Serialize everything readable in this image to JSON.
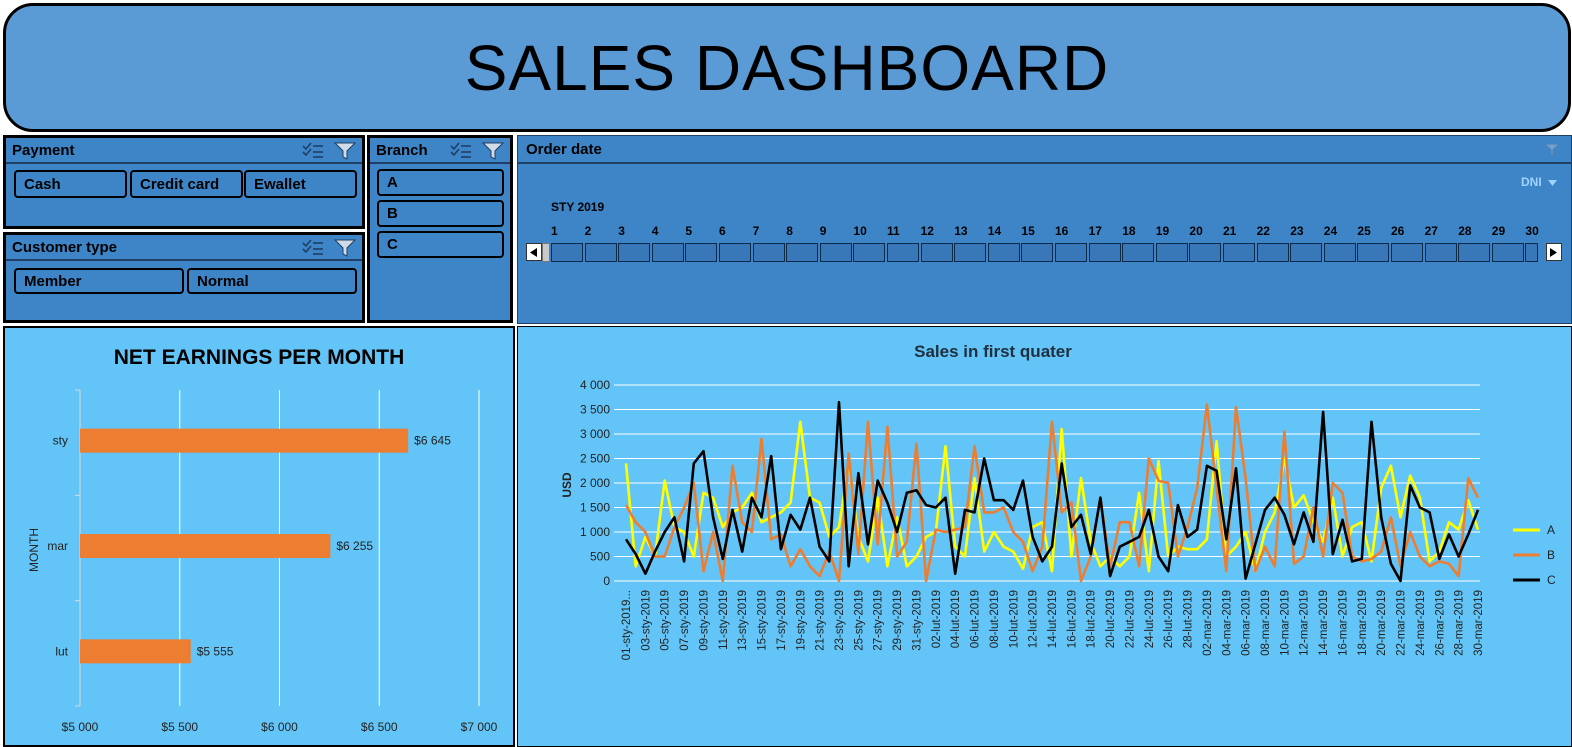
{
  "header": {
    "title": "SALES DASHBOARD"
  },
  "payment_slicer": {
    "title": "Payment",
    "items": [
      {
        "label": "Cash"
      },
      {
        "label": "Credit card"
      },
      {
        "label": "Ewallet"
      }
    ],
    "icons": [
      "multi-select-icon",
      "clear-filter-icon"
    ]
  },
  "customer_slicer": {
    "title": "Customer type",
    "items": [
      {
        "label": "Member"
      },
      {
        "label": "Normal"
      }
    ],
    "icons": [
      "multi-select-icon",
      "clear-filter-icon"
    ]
  },
  "branch_slicer": {
    "title": "Branch",
    "items": [
      {
        "label": "A"
      },
      {
        "label": "B"
      },
      {
        "label": "C"
      }
    ],
    "icons": [
      "multi-select-icon",
      "clear-filter-icon"
    ]
  },
  "timeline": {
    "title": "Order date",
    "level": "DNI",
    "month": "STY 2019",
    "days": [
      "1",
      "2",
      "3",
      "4",
      "5",
      "6",
      "7",
      "8",
      "9",
      "10",
      "11",
      "12",
      "13",
      "14",
      "15",
      "16",
      "17",
      "18",
      "19",
      "20",
      "21",
      "22",
      "23",
      "24",
      "25",
      "26",
      "27",
      "28",
      "29",
      "30"
    ],
    "icons": [
      "clear-filter-icon",
      "scroll-left-icon",
      "scroll-right-icon",
      "chevron-down-icon"
    ]
  },
  "colors": {
    "panel": "#63c5f7",
    "slicer": "#3d85c6",
    "header": "#5b9bd5",
    "bar": "#ed7d31",
    "seriesA": "#ffff00",
    "seriesB": "#ed7d31",
    "seriesC": "#000000"
  },
  "chart_data": [
    {
      "type": "bar",
      "orientation": "horizontal",
      "title": "NET EARNINGS PER MONTH",
      "ylabel": "MONTH",
      "categories": [
        "sty",
        "mar",
        "lut"
      ],
      "values": [
        6645,
        6255,
        5555
      ],
      "data_labels": [
        "$6 645",
        "$6 255",
        "$5 555"
      ],
      "xlim": [
        5000,
        7000
      ],
      "xticks": [
        5000,
        5500,
        6000,
        6500,
        7000
      ],
      "xtick_labels": [
        "$5 000",
        "$5 500",
        "$6 000",
        "$6 500",
        "$7 000"
      ],
      "grid": true
    },
    {
      "type": "line",
      "title": "Sales in first quater",
      "ylabel": "USD",
      "ylim": [
        0,
        4000
      ],
      "yticks": [
        0,
        500,
        1000,
        1500,
        2000,
        2500,
        3000,
        3500,
        4000
      ],
      "ytick_labels": [
        "0",
        "500",
        "1 000",
        "1 500",
        "2 000",
        "2 500",
        "3 000",
        "3 500",
        "4 000"
      ],
      "legend": "right",
      "x": [
        "01-sty-2019",
        "02-sty-2019",
        "03-sty-2019",
        "04-sty-2019",
        "05-sty-2019",
        "06-sty-2019",
        "07-sty-2019",
        "08-sty-2019",
        "09-sty-2019",
        "10-sty-2019",
        "11-sty-2019",
        "12-sty-2019",
        "13-sty-2019",
        "14-sty-2019",
        "15-sty-2019",
        "16-sty-2019",
        "17-sty-2019",
        "18-sty-2019",
        "19-sty-2019",
        "20-sty-2019",
        "21-sty-2019",
        "22-sty-2019",
        "23-sty-2019",
        "24-sty-2019",
        "25-sty-2019",
        "26-sty-2019",
        "27-sty-2019",
        "28-sty-2019",
        "29-sty-2019",
        "30-sty-2019",
        "31-sty-2019",
        "01-lut-2019",
        "02-lut-2019",
        "03-lut-2019",
        "04-lut-2019",
        "05-lut-2019",
        "06-lut-2019",
        "07-lut-2019",
        "08-lut-2019",
        "09-lut-2019",
        "10-lut-2019",
        "11-lut-2019",
        "12-lut-2019",
        "13-lut-2019",
        "14-lut-2019",
        "15-lut-2019",
        "16-lut-2019",
        "17-lut-2019",
        "18-lut-2019",
        "19-lut-2019",
        "20-lut-2019",
        "21-lut-2019",
        "22-lut-2019",
        "23-lut-2019",
        "24-lut-2019",
        "25-lut-2019",
        "26-lut-2019",
        "27-lut-2019",
        "28-lut-2019",
        "01-mar-2019",
        "02-mar-2019",
        "03-mar-2019",
        "04-mar-2019",
        "05-mar-2019",
        "06-mar-2019",
        "07-mar-2019",
        "08-mar-2019",
        "09-mar-2019",
        "10-mar-2019",
        "11-mar-2019",
        "12-mar-2019",
        "13-mar-2019",
        "14-mar-2019",
        "15-mar-2019",
        "16-mar-2019",
        "17-mar-2019",
        "18-mar-2019",
        "19-mar-2019",
        "20-mar-2019",
        "21-mar-2019",
        "22-mar-2019",
        "23-mar-2019",
        "24-mar-2019",
        "25-mar-2019",
        "26-mar-2019",
        "27-mar-2019",
        "28-mar-2019",
        "29-mar-2019",
        "30-mar-2019"
      ],
      "x_tick_labels": [
        "01-sty-2019...",
        "03-sty-2019",
        "05-sty-2019",
        "07-sty-2019",
        "09-sty-2019",
        "11-sty-2019",
        "13-sty-2019",
        "15-sty-2019",
        "17-sty-2019",
        "19-sty-2019",
        "21-sty-2019",
        "23-sty-2019",
        "25-sty-2019",
        "27-sty-2019",
        "29-sty-2019",
        "31-sty-2019",
        "02-lut-2019",
        "04-lut-2019",
        "06-lut-2019",
        "08-lut-2019",
        "10-lut-2019",
        "12-lut-2019",
        "14-lut-2019",
        "16-lut-2019",
        "18-lut-2019",
        "20-lut-2019",
        "22-lut-2019",
        "24-lut-2019",
        "26-lut-2019",
        "28-lut-2019",
        "02-mar-2019",
        "04-mar-2019",
        "06-mar-2019",
        "08-mar-2019",
        "10-mar-2019",
        "12-mar-2019",
        "14-mar-2019",
        "16-mar-2019",
        "18-mar-2019",
        "20-mar-2019",
        "22-mar-2019",
        "24-mar-2019",
        "26-mar-2019",
        "28-mar-2019",
        "30-mar-2019"
      ],
      "series": [
        {
          "name": "A",
          "color": "#ffff00",
          "values": [
            2400,
            300,
            900,
            500,
            2050,
            1100,
            1000,
            500,
            1800,
            1700,
            1100,
            1400,
            1500,
            1800,
            1200,
            1300,
            1400,
            1600,
            3250,
            1700,
            1600,
            900,
            1100,
            2400,
            900,
            400,
            1700,
            300,
            1300,
            300,
            500,
            900,
            1000,
            2750,
            700,
            500,
            2100,
            600,
            1000,
            700,
            600,
            250,
            1100,
            1200,
            200,
            3100,
            500,
            2100,
            800,
            300,
            500,
            300,
            500,
            1800,
            200,
            2450,
            500,
            700,
            650,
            650,
            850,
            2850,
            500,
            700,
            1000,
            200,
            1000,
            1400,
            2500,
            1500,
            1750,
            1200,
            800,
            1700,
            500,
            1100,
            1200,
            400,
            1900,
            2350,
            1300,
            2150,
            1700,
            400,
            600,
            1200,
            1050,
            1650,
            1050
          ]
        },
        {
          "name": "B",
          "color": "#ed7d31",
          "values": [
            1550,
            1200,
            1000,
            500,
            500,
            1100,
            1500,
            2000,
            200,
            1000,
            0,
            2350,
            1200,
            1000,
            2900,
            850,
            950,
            300,
            650,
            300,
            100,
            600,
            0,
            2600,
            550,
            3250,
            750,
            3150,
            500,
            800,
            2800,
            0,
            1050,
            1000,
            1050,
            1100,
            2750,
            1400,
            1400,
            1500,
            1000,
            800,
            200,
            700,
            3250,
            1400,
            1600,
            0,
            500,
            1700,
            300,
            1200,
            1200,
            300,
            2500,
            2050,
            2000,
            500,
            1100,
            1900,
            3600,
            1900,
            200,
            3550,
            2100,
            200,
            700,
            300,
            3050,
            350,
            500,
            1500,
            500,
            2000,
            1800,
            500,
            400,
            450,
            600,
            1300,
            300,
            1000,
            500,
            300,
            400,
            350,
            100,
            2100,
            1700
          ]
        },
        {
          "name": "C",
          "color": "#000000",
          "values": [
            850,
            550,
            150,
            600,
            1000,
            1300,
            400,
            2400,
            2650,
            1300,
            450,
            1450,
            600,
            1700,
            1300,
            2550,
            650,
            1350,
            1050,
            1700,
            700,
            400,
            3650,
            300,
            2200,
            750,
            2050,
            1600,
            1000,
            1800,
            1850,
            1550,
            1500,
            1700,
            150,
            1450,
            1400,
            2500,
            1650,
            1650,
            1450,
            2050,
            900,
            400,
            700,
            2400,
            1100,
            1350,
            550,
            1700,
            100,
            700,
            800,
            900,
            1450,
            500,
            200,
            1550,
            900,
            1050,
            2350,
            2250,
            850,
            2300,
            50,
            750,
            1450,
            1700,
            1350,
            750,
            1400,
            800,
            3450,
            550,
            1250,
            400,
            450,
            3250,
            1300,
            350,
            0,
            1950,
            1500,
            1400,
            450,
            950,
            500,
            950,
            1450
          ]
        }
      ]
    }
  ]
}
